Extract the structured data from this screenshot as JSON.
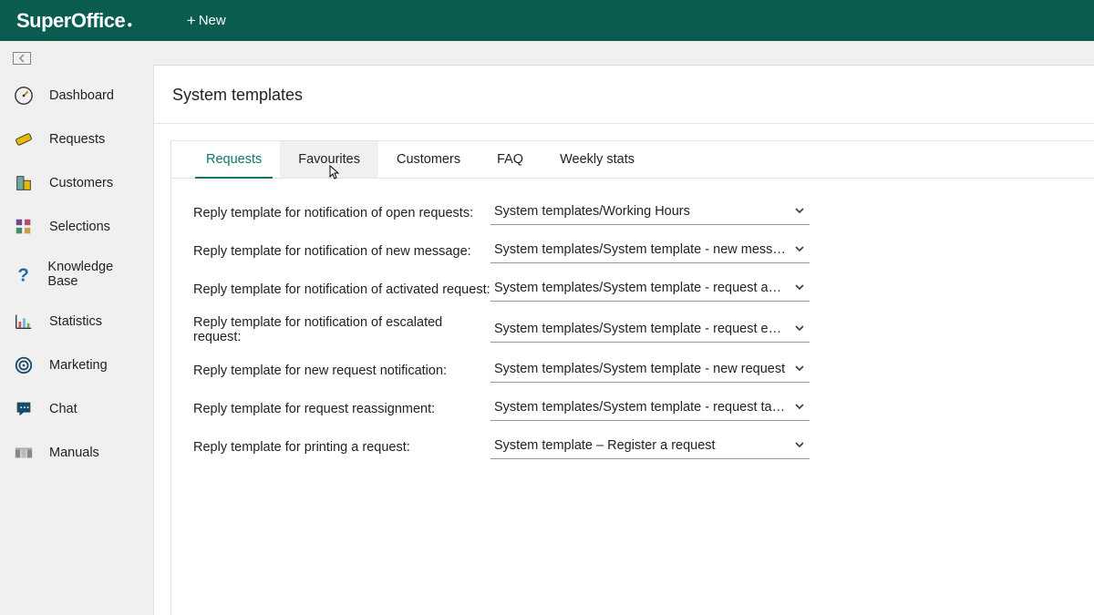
{
  "header": {
    "logo": "SuperOffice",
    "new_label": "New"
  },
  "sidebar": {
    "items": [
      {
        "label": "Dashboard",
        "icon": "gauge"
      },
      {
        "label": "Requests",
        "icon": "ticket"
      },
      {
        "label": "Customers",
        "icon": "building"
      },
      {
        "label": "Selections",
        "icon": "grid"
      },
      {
        "label": "Knowledge Base",
        "icon": "question"
      },
      {
        "label": "Statistics",
        "icon": "chart"
      },
      {
        "label": "Marketing",
        "icon": "target"
      },
      {
        "label": "Chat",
        "icon": "chat"
      },
      {
        "label": "Manuals",
        "icon": "manuals"
      }
    ]
  },
  "page": {
    "title": "System templates",
    "tabs": [
      {
        "label": "Requests",
        "active": true
      },
      {
        "label": "Favourites",
        "hover": true
      },
      {
        "label": "Customers"
      },
      {
        "label": "FAQ"
      },
      {
        "label": "Weekly stats"
      }
    ],
    "rows": [
      {
        "label": "Reply template for notification of open requests:",
        "value": "System templates/Working Hours"
      },
      {
        "label": "Reply template for notification of new message:",
        "value": "System templates/System template - new message"
      },
      {
        "label": "Reply template for notification of activated request:",
        "value": "System templates/System template - request activated"
      },
      {
        "label": "Reply template for notification of escalated request:",
        "value": "System templates/System template - request escalated"
      },
      {
        "label": "Reply template for new request notification:",
        "value": "System templates/System template - new request"
      },
      {
        "label": "Reply template for request reassignment:",
        "value": "System templates/System template - request taken ove"
      },
      {
        "label": "Reply template for printing a request:",
        "value": "System template – Register a request"
      }
    ]
  }
}
